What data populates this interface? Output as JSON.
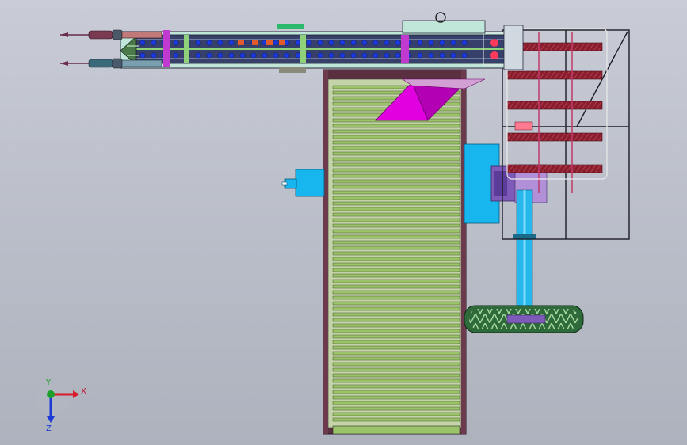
{
  "viewport": {
    "background_top": "#c9ccd6",
    "background_bottom": "#aeb2bd"
  },
  "model": {
    "conveyor_slat_color": "#9bc46a",
    "conveyor_frame_color": "#6b3b4d",
    "boom_color": "#3a3f66",
    "hopper_color": "#e000e0",
    "motor_color": "#18b6ef",
    "wheel_color": "#2f6b3a",
    "reel_bar_color": "#9a2a3a",
    "frame_color": "#1c1c24"
  },
  "triad": {
    "x_label": "X",
    "y_label": "Y",
    "z_label": "Z",
    "x_color": "#d81a2a",
    "y_color": "#1aa02a",
    "z_color": "#1a3ad8"
  }
}
